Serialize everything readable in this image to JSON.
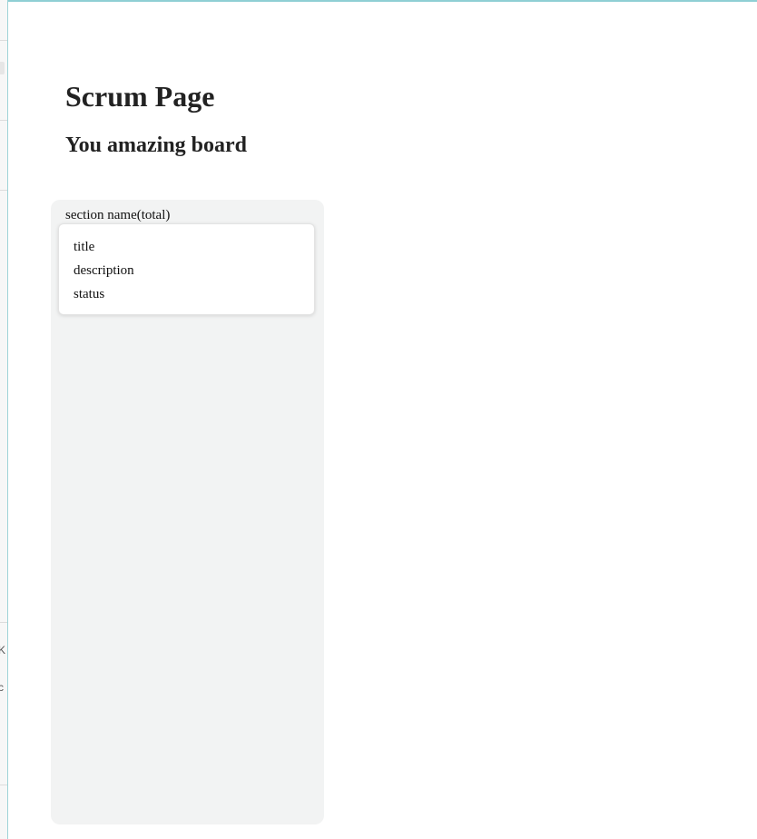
{
  "page": {
    "title": "Scrum Page",
    "board_title": "You amazing board"
  },
  "sections": [
    {
      "header": "section name(total)",
      "cards": [
        {
          "title": "title",
          "description": "description",
          "status": "status"
        }
      ]
    }
  ],
  "left_window_sliver": {
    "text_1": "K",
    "text_2": "c"
  },
  "colors": {
    "section_background": "#f2f3f3",
    "card_background": "#ffffff",
    "window_accent": "#8fcfd4"
  }
}
